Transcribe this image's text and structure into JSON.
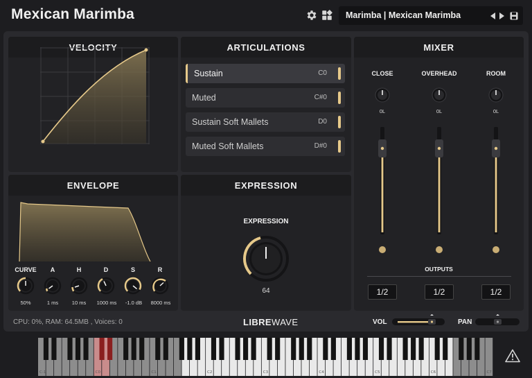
{
  "app": {
    "title": "Mexican Marimba"
  },
  "header": {
    "settings_icon": "gear-icon",
    "view_icon": "grid-icon",
    "preset": "Marimba | Mexican Marimba",
    "prev_icon": "triangle-left-icon",
    "next_icon": "triangle-right-icon",
    "save_icon": "save-icon"
  },
  "velocity": {
    "title": "VELOCITY"
  },
  "articulations": {
    "title": "ARTICULATIONS",
    "items": [
      {
        "label": "Sustain",
        "note": "C0"
      },
      {
        "label": "Muted",
        "note": "C#0"
      },
      {
        "label": "Sustain Soft Mallets",
        "note": "D0"
      },
      {
        "label": "Muted Soft Mallets",
        "note": "D#0"
      }
    ]
  },
  "mixer": {
    "title": "MIXER",
    "channels": [
      {
        "name": "CLOSE",
        "pan": "0L",
        "output": "1/2"
      },
      {
        "name": "OVERHEAD",
        "pan": "0L",
        "output": "1/2"
      },
      {
        "name": "ROOM",
        "pan": "0L",
        "output": "1/2"
      }
    ],
    "outputs_label": "OUTPUTS"
  },
  "envelope": {
    "title": "ENVELOPE",
    "knobs": [
      {
        "label": "CURVE",
        "value": "50%"
      },
      {
        "label": "A",
        "value": "1 ms"
      },
      {
        "label": "H",
        "value": "10 ms"
      },
      {
        "label": "D",
        "value": "1000 ms"
      },
      {
        "label": "S",
        "value": "-1.0 dB"
      },
      {
        "label": "R",
        "value": "8000 ms"
      }
    ]
  },
  "expression": {
    "title": "EXPRESSION",
    "label": "EXPRESSION",
    "value": "64"
  },
  "footer": {
    "status": "CPU: 0%, RAM: 64.5MB , Voices: 0",
    "logo_bold": "LIBRE",
    "logo_light": "WAVE",
    "vol_label": "VOL",
    "pan_label": "PAN"
  },
  "keyboard": {
    "octave_labels": [
      "C-1",
      "C0",
      "C1",
      "C2",
      "C3",
      "C4",
      "C5",
      "C6",
      "C7"
    ],
    "key_switch_color": "#c98c8c",
    "playable_color": "#e9e9e9",
    "unmapped_color": "#8d8d8d"
  },
  "warning_icon": "warning-icon",
  "colors": {
    "accent": "#e6c98a",
    "panel": "#222225",
    "background": "#1d1d20"
  }
}
